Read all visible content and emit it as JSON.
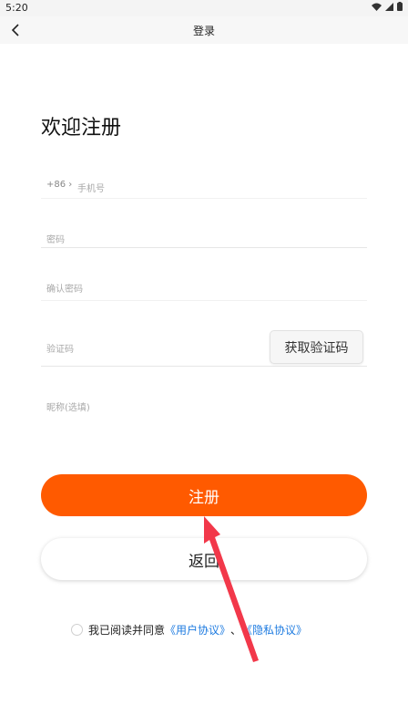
{
  "status_bar": {
    "time": "5:20"
  },
  "nav": {
    "title": "登录",
    "back_icon": "chevron-left-icon"
  },
  "heading": "欢迎注册",
  "form": {
    "phone_prefix": "+86",
    "phone_placeholder": "手机号",
    "password_placeholder": "密码",
    "confirm_password_placeholder": "确认密码",
    "code_placeholder": "验证码",
    "get_code_label": "获取验证码",
    "nickname_placeholder": "昵称(选填)"
  },
  "buttons": {
    "register": "注册",
    "back": "返回"
  },
  "agreement": {
    "text": "我已阅读并同意",
    "user_agreement": "《用户协议》",
    "separator": "、",
    "privacy_policy": "《隐私协议》"
  },
  "colors": {
    "primary": "#ff5a00",
    "link": "#1e7be0",
    "annotation_arrow": "#f2384a"
  }
}
